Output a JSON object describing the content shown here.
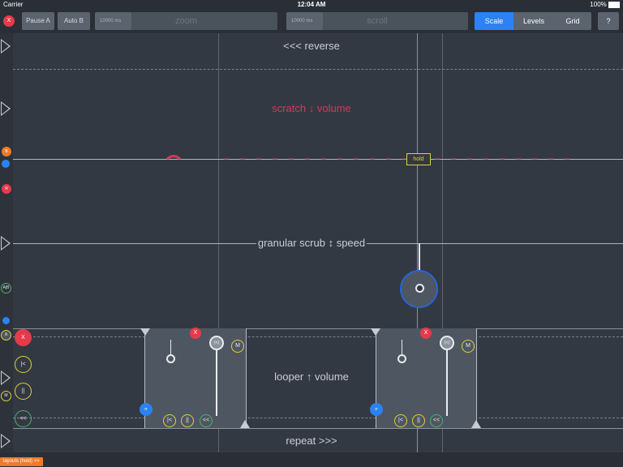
{
  "status": {
    "carrier": "Carrier",
    "time": "12:04 AM",
    "battery": "100%"
  },
  "toolbar": {
    "close": "X",
    "pause_a": "Pause A",
    "auto_b": "Auto B",
    "zoom_ms": "10000 ms",
    "zoom_label": "zoom",
    "scroll_ms": "10000 ms",
    "scroll_label": "scroll",
    "scale": "Scale",
    "levels": "Levels",
    "grid": "Grid",
    "help": "?"
  },
  "lanes": {
    "reverse": "<<< reverse",
    "scratch": "scratch ↓ volume",
    "granular": "granular scrub ↕ speed",
    "looper": "looper ↑ volume",
    "repeat": "repeat >>>",
    "hold": "hold"
  },
  "side": {
    "b": "B",
    "r": "R",
    "ab": "A|B",
    "a": "A",
    "m": "M",
    "x": "X",
    "prev": "|<",
    "pause": "||",
    "rew": "<<"
  },
  "loopers": [
    {
      "x": "X",
      "m": "M",
      "rr": "rr",
      "prev": "|<",
      "pause": "||",
      "rew": "<<",
      "dd": "(<)"
    },
    {
      "x": "X",
      "m": "M",
      "rr": "rr",
      "prev": "|<",
      "pause": "||",
      "rew": "<<",
      "dd": "(<)"
    }
  ],
  "footer": {
    "layouts": "layouts (hold) >>"
  },
  "colors": {
    "accent_blue": "#2a82f5",
    "red": "#e53a4b",
    "orange": "#f07a2a",
    "yellow": "#e2cf3a",
    "green": "#4fb06a",
    "scratch_pink": "#d23a5a"
  }
}
